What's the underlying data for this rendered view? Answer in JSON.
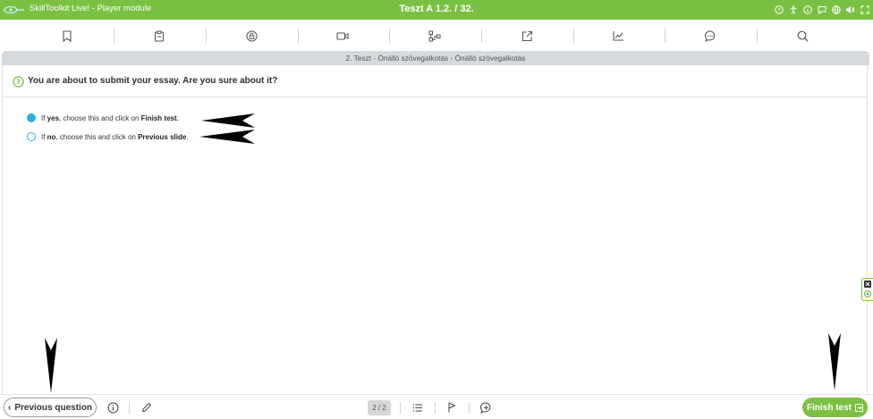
{
  "window": {
    "app_name": "SkillToolkit Live! - Player module",
    "title": "Teszt A 1.2. / 32.",
    "controls": [
      "help-icon",
      "accessibility-icon",
      "info-icon",
      "comment-icon",
      "translate-icon",
      "volume-icon",
      "fullscreen-icon"
    ]
  },
  "toolbar": {
    "items": [
      "bookmark-icon",
      "clipboard-icon",
      "lock-icon",
      "video-icon",
      "flow-icon",
      "external-link-icon",
      "chart-icon",
      "chat-icon",
      "search-icon"
    ]
  },
  "breadcrumb": "2. Teszt - Önálló szövegalkotás - Önálló szövegalkotás",
  "question": {
    "text": "You are about to submit your essay. Are you sure about it?",
    "options": [
      {
        "pre": "If ",
        "bold1": "yes",
        "mid": ", choose this and click on ",
        "bold2": "Finish test",
        "post": ".",
        "selected": true
      },
      {
        "pre": "If ",
        "bold1": "no",
        "mid": ", choose this and click on ",
        "bold2": "Previous slide",
        "post": ".",
        "selected": false
      }
    ]
  },
  "footer": {
    "previous_label": "Previous question",
    "page_indicator": "2 / 2",
    "finish_label": "Finish test"
  },
  "colors": {
    "brand_green": "#7ac143",
    "radio_blue": "#2bb0d6"
  }
}
